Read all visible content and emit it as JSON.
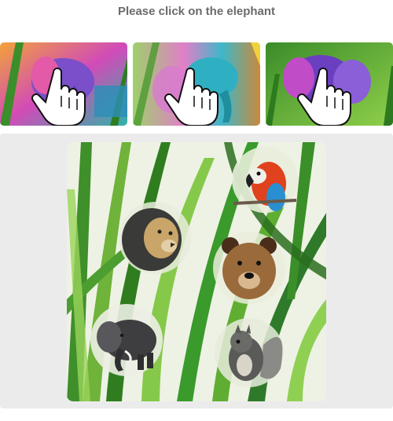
{
  "instruction": {
    "text": "Please click on the elephant"
  },
  "examples": [
    {
      "icon": "hand-pointer-icon",
      "subject": "elephant"
    },
    {
      "icon": "hand-pointer-icon",
      "subject": "elephant"
    },
    {
      "icon": "hand-pointer-icon",
      "subject": "elephant"
    }
  ],
  "scene": {
    "background": "tall green grass leaves",
    "animals": [
      "parrot",
      "lion",
      "bear",
      "elephant",
      "squirrel"
    ]
  },
  "colors": {
    "instruction_text": "#6b6b6b",
    "panel_background": "#ebebeb",
    "grass_dark": "#2f7d1f",
    "grass_light": "#7cc242",
    "accent": "#2aa39a"
  }
}
